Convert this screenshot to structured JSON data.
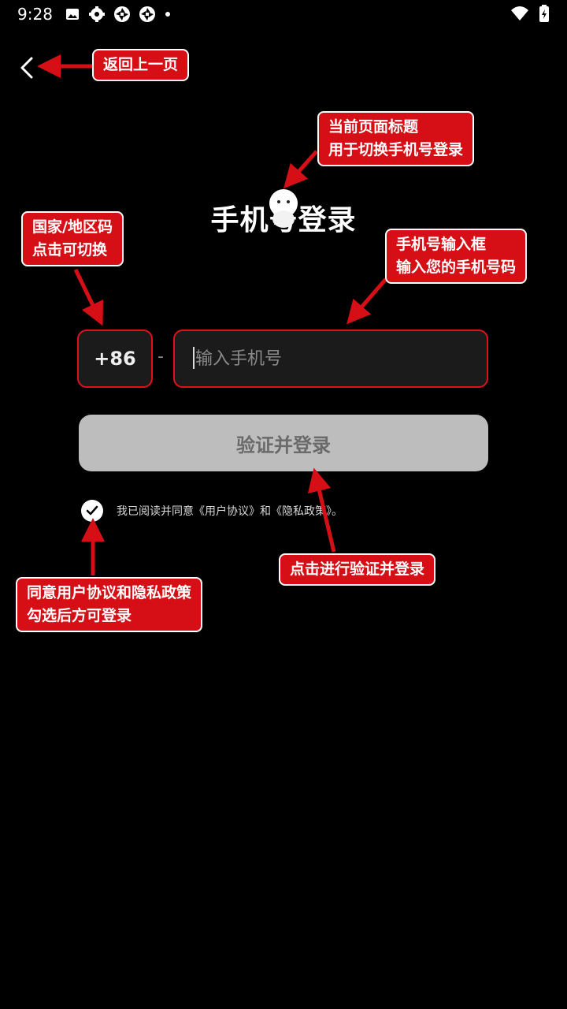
{
  "status_bar": {
    "time": "9:28",
    "icons": [
      "image-icon",
      "gear-icon",
      "app-icon",
      "app-icon",
      "dot-icon"
    ],
    "right_icons": [
      "wifi-icon",
      "battery-icon"
    ]
  },
  "header": {
    "back_icon": "chevron-left-icon"
  },
  "title": {
    "text": "手机号登录"
  },
  "form": {
    "country_code": "+86",
    "separator": "-",
    "phone_placeholder": "输入手机号",
    "phone_value": "",
    "submit_label": "验证并登录"
  },
  "agreement": {
    "checked": true,
    "text_prefix": "我已阅读并同意",
    "user_agreement": "《用户协议》",
    "and": "和",
    "privacy_policy": "《隐私政策》",
    "suffix": "。"
  },
  "annotations": {
    "back": "返回上一页",
    "title_line1": "当前页面标题",
    "title_line2": "用于切换手机号登录",
    "country_line1": "国家/地区码",
    "country_line2": "点击可切换",
    "phone_line1": "手机号输入框",
    "phone_line2": "输入您的手机号码",
    "submit": "点击进行验证并登录",
    "agree_line1": "同意用户协议和隐私政策",
    "agree_line2": "勾选后方可登录"
  },
  "colors": {
    "accent": "#d60f16",
    "border": "#e3101c",
    "button_bg": "#bdbdbd"
  }
}
